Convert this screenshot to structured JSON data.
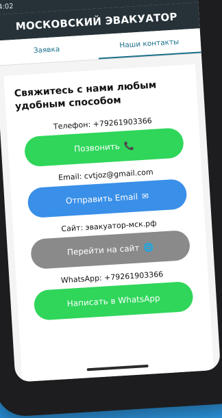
{
  "status": {
    "time": "4:02"
  },
  "appbar": {
    "title": "МОСКОВСКИЙ ЭВАКУАТОР"
  },
  "tabs": [
    {
      "label": "Заявка",
      "active": false
    },
    {
      "label": "Наши контакты",
      "active": true
    }
  ],
  "contacts": {
    "heading": "Свяжитесь с нами любым удобным способом",
    "phone": {
      "label": "Телефон: +79261903366",
      "button": "Позвонить",
      "icon": "phone-icon"
    },
    "email": {
      "label": "Email: cvtjoz@gmail.com",
      "button": "Отправить Email",
      "icon": "mail-icon"
    },
    "site": {
      "label": "Сайт: эвакуатор-мск.рф",
      "button": "Перейти на сайт",
      "icon": "globe-icon"
    },
    "whatsapp": {
      "label": "WhatsApp: +79261903366",
      "button": "Написать в WhatsApp"
    }
  },
  "colors": {
    "appbar": "#263238",
    "green": "#2fd65a",
    "blue": "#3a8fe8",
    "grey": "#8a8a8a",
    "tab": "#1a6f8a"
  }
}
